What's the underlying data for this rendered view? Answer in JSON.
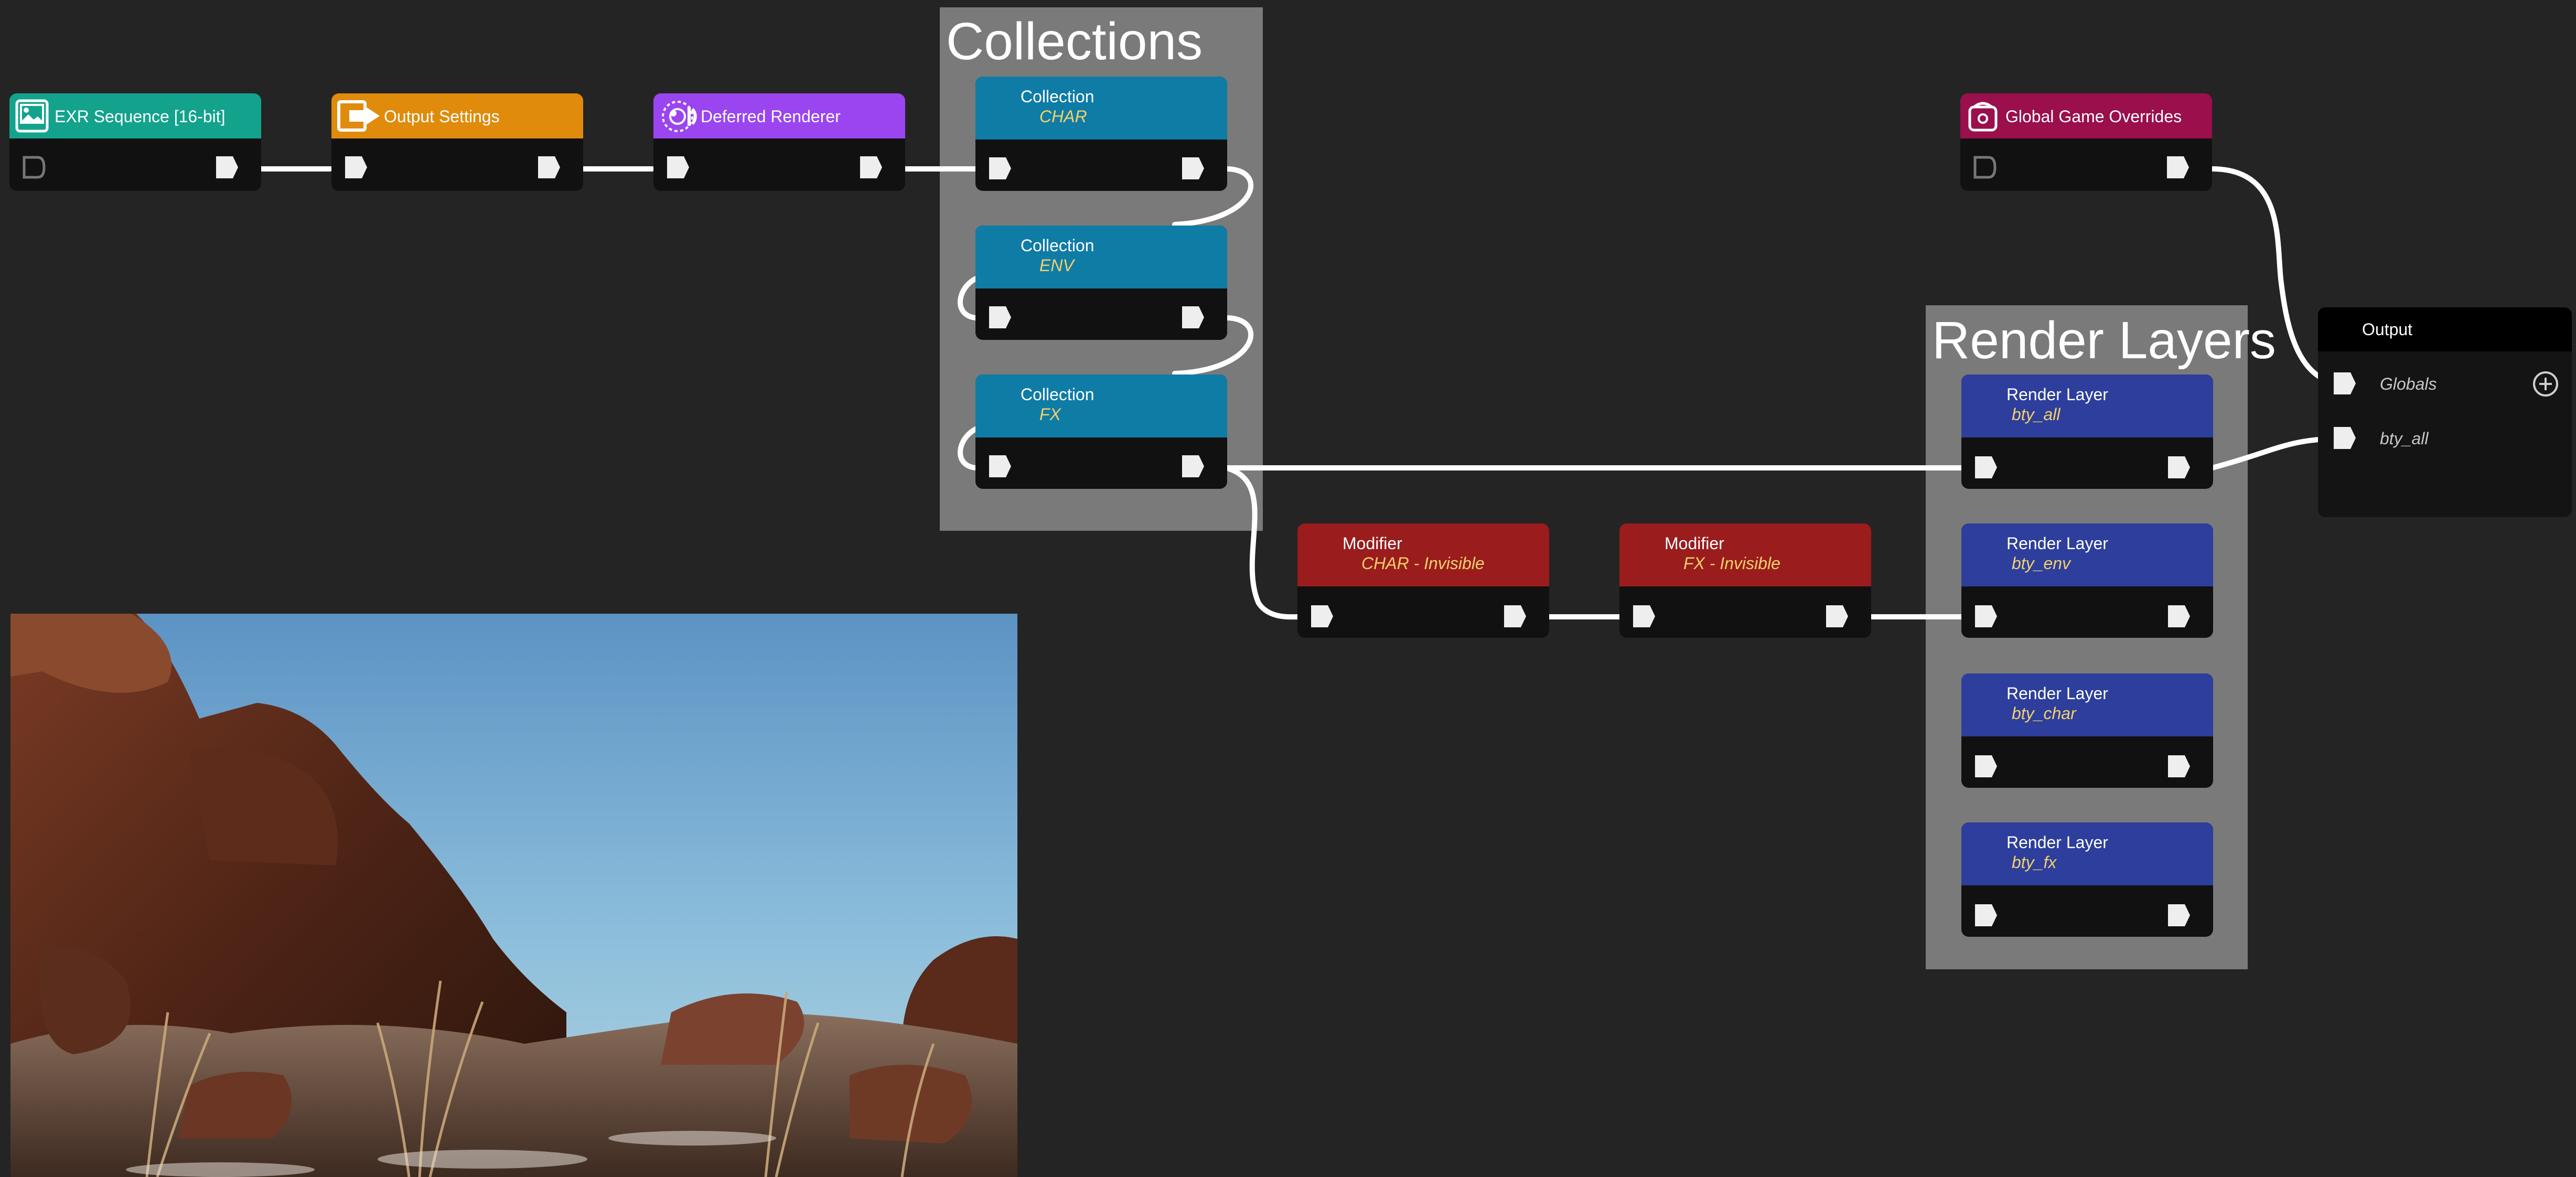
{
  "colors": {
    "background": "#242424",
    "group_box": "#7a7a7a",
    "node_body": "#111111",
    "exr": "#13a38d",
    "output_settings": "#e08b0b",
    "deferred": "#9a45f0",
    "collection": "#0f7ca6",
    "global_overrides": "#9a0f4c",
    "modifier": "#9a1c1d",
    "render_layer": "#2d3e9c",
    "subtitle": "#f2d16b",
    "wire": "#ffffff"
  },
  "groups": {
    "collections": {
      "title": "Collections"
    },
    "render_layers": {
      "title": "Render Layers"
    }
  },
  "nodes": {
    "exr": {
      "label": "EXR Sequence [16-bit]",
      "icon": "image-icon"
    },
    "output_settings": {
      "label": "Output Settings",
      "icon": "export-icon"
    },
    "deferred": {
      "label": "Deferred Renderer",
      "icon": "render-icon"
    },
    "global_overrides": {
      "label": "Global Game Overrides",
      "icon": "box-icon"
    },
    "col_char": {
      "type": "Collection",
      "name": "CHAR"
    },
    "col_env": {
      "type": "Collection",
      "name": "ENV"
    },
    "col_fx": {
      "type": "Collection",
      "name": "FX"
    },
    "mod_char": {
      "type": "Modifier",
      "name": "CHAR - Invisible"
    },
    "mod_fx": {
      "type": "Modifier",
      "name": "FX - Invisible"
    },
    "rl_all": {
      "type": "Render Layer",
      "name": "bty_all"
    },
    "rl_env": {
      "type": "Render Layer",
      "name": "bty_env"
    },
    "rl_char": {
      "type": "Render Layer",
      "name": "bty_char"
    },
    "rl_fx": {
      "type": "Render Layer",
      "name": "bty_fx"
    }
  },
  "output": {
    "title": "Output",
    "ports": [
      "Globals",
      "bty_all"
    ],
    "add_icon": "plus-circle-icon"
  }
}
